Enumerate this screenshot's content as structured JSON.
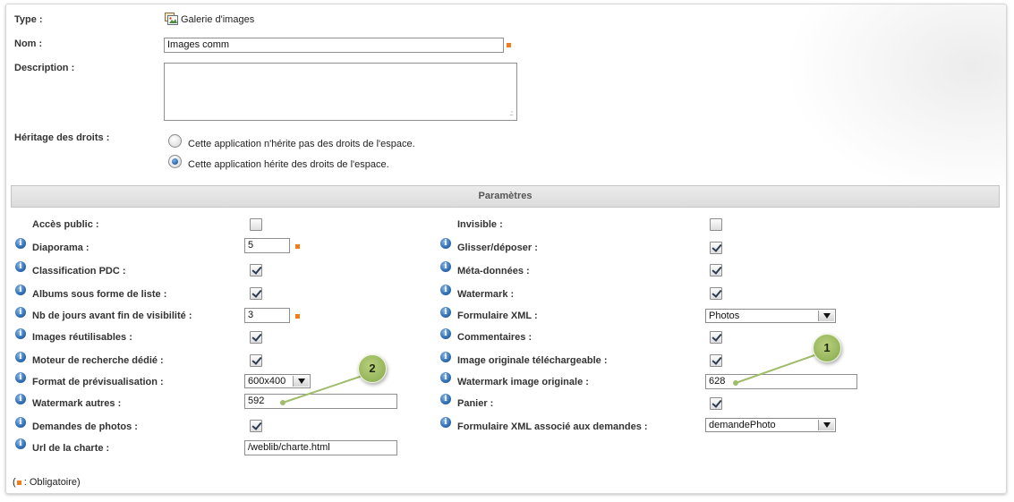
{
  "general": {
    "type_label": "Type :",
    "type_value": "Galerie d'images",
    "name_label": "Nom :",
    "name_value": "Images comm",
    "description_label": "Description :",
    "description_value": "",
    "rights_label": "Héritage des droits :",
    "rights_options": [
      {
        "label": "Cette application n'hérite pas des droits de l'espace.",
        "selected": false
      },
      {
        "label": "Cette application hérite des droits de l'espace.",
        "selected": true
      }
    ]
  },
  "params": {
    "title": "Paramètres",
    "left": [
      {
        "label": "Accès public :",
        "info": false,
        "control": "checkbox",
        "checked": false
      },
      {
        "label": "Diaporama :",
        "info": true,
        "control": "text",
        "value": "5",
        "required": true
      },
      {
        "label": "Classification PDC :",
        "info": true,
        "control": "checkbox",
        "checked": true
      },
      {
        "label": "Albums sous forme de liste :",
        "info": true,
        "control": "checkbox",
        "checked": true
      },
      {
        "label": "Nb de jours avant fin de visibilité :",
        "info": true,
        "control": "text",
        "value": "3",
        "required": true
      },
      {
        "label": "Images réutilisables :",
        "info": true,
        "control": "checkbox",
        "checked": true
      },
      {
        "label": "Moteur de recherche dédié :",
        "info": true,
        "control": "checkbox",
        "checked": true
      },
      {
        "label": "Format de prévisualisation :",
        "info": true,
        "control": "select",
        "value": "600x400"
      },
      {
        "label": "Watermark autres :",
        "info": true,
        "control": "text",
        "value": "592"
      },
      {
        "label": "Demandes de photos :",
        "info": true,
        "control": "checkbox",
        "checked": true
      },
      {
        "label": "Url de la charte :",
        "info": true,
        "control": "text",
        "value": "/weblib/charte.html"
      }
    ],
    "right": [
      {
        "label": "Invisible :",
        "info": false,
        "control": "checkbox",
        "checked": false
      },
      {
        "label": "Glisser/déposer :",
        "info": true,
        "control": "checkbox",
        "checked": true
      },
      {
        "label": "Méta-données :",
        "info": true,
        "control": "checkbox",
        "checked": true
      },
      {
        "label": "Watermark :",
        "info": true,
        "control": "checkbox",
        "checked": true
      },
      {
        "label": "Formulaire XML :",
        "info": true,
        "control": "select",
        "value": "Photos"
      },
      {
        "label": "Commentaires :",
        "info": true,
        "control": "checkbox",
        "checked": true
      },
      {
        "label": "Image originale téléchargeable :",
        "info": true,
        "control": "checkbox",
        "checked": true
      },
      {
        "label": "Watermark image originale :",
        "info": true,
        "control": "text",
        "value": "628"
      },
      {
        "label": "Panier :",
        "info": true,
        "control": "checkbox",
        "checked": true
      },
      {
        "label": "Formulaire XML associé aux demandes :",
        "info": true,
        "control": "select",
        "value": "demandePhoto"
      }
    ]
  },
  "footer": {
    "required_note_open": "(",
    "required_note": " : Obligatoire)"
  },
  "callouts": [
    {
      "number": "1"
    },
    {
      "number": "2"
    }
  ],
  "colors": {
    "required_marker": "#f07d1a",
    "callout_fill": "#95b55a",
    "info_icon": "#2d6db5"
  }
}
